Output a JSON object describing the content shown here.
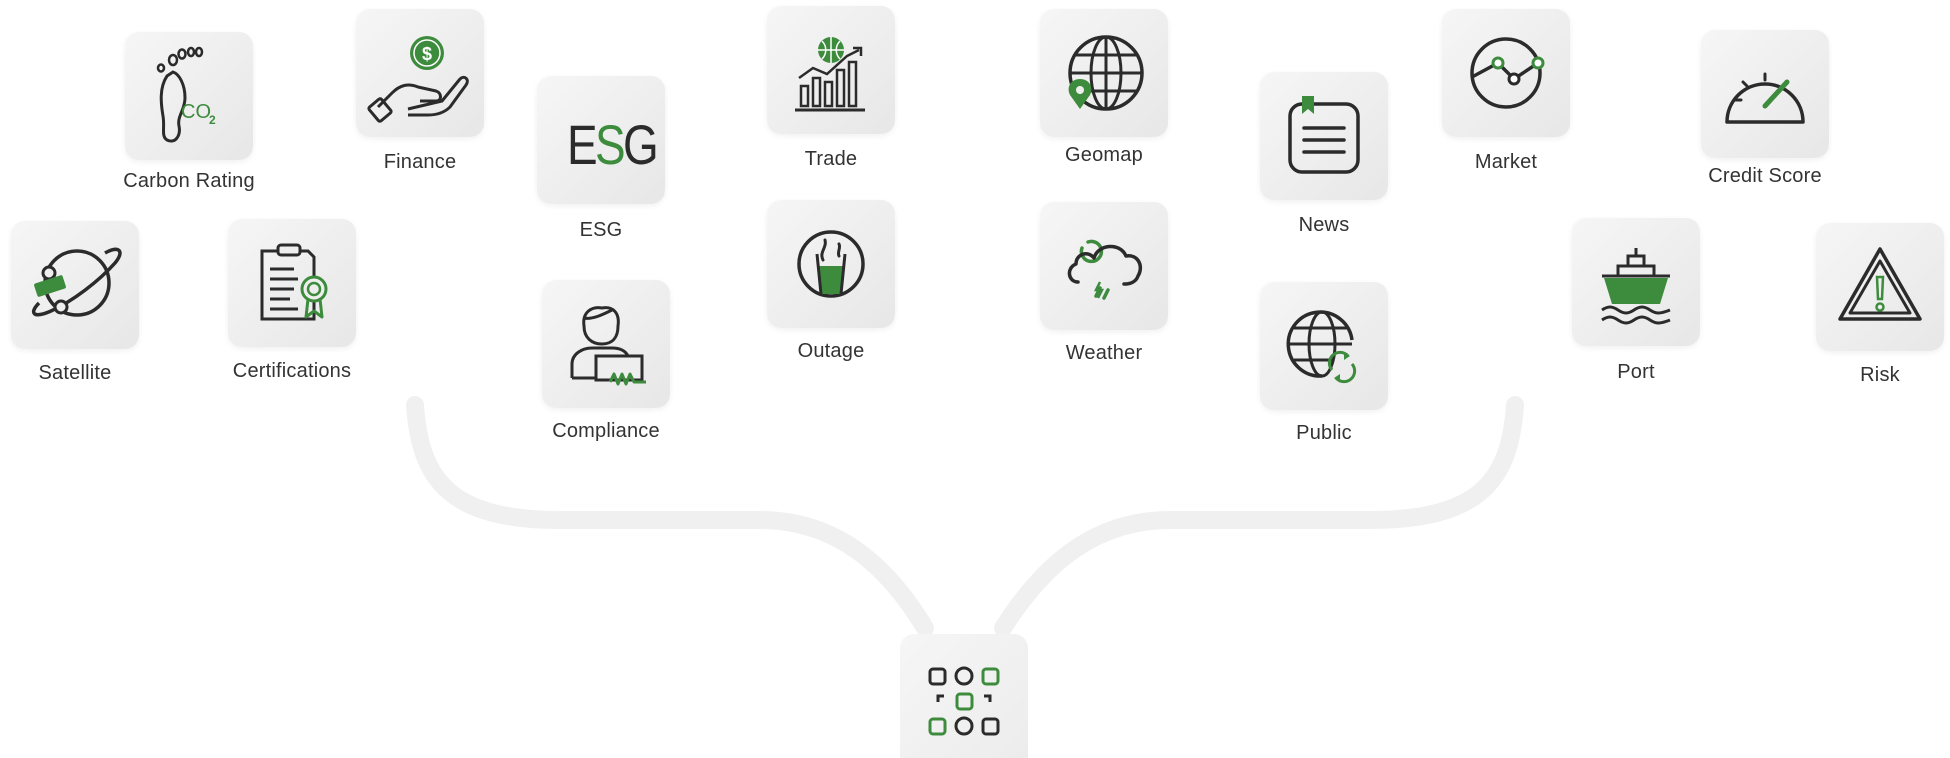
{
  "colors": {
    "accent": "#3d8b3d",
    "icon": "#2b2b2b",
    "tile": "#eeeeee",
    "connector": "#eeeeee",
    "label": "#333333"
  },
  "hub": {
    "icon": "apps-grid-icon"
  },
  "nodes": [
    {
      "label": "Carbon Rating",
      "icon": "carbon-footprint-icon"
    },
    {
      "label": "Finance",
      "icon": "money-hand-icon"
    },
    {
      "label": "ESG",
      "icon": "esg-icon"
    },
    {
      "label": "Trade",
      "icon": "trade-chart-icon"
    },
    {
      "label": "Geomap",
      "icon": "globe-pin-icon"
    },
    {
      "label": "News",
      "icon": "news-icon"
    },
    {
      "label": "Market",
      "icon": "market-line-icon"
    },
    {
      "label": "Credit Score",
      "icon": "speedometer-icon"
    },
    {
      "label": "Satellite",
      "icon": "satellite-icon"
    },
    {
      "label": "Certifications",
      "icon": "certificate-icon"
    },
    {
      "label": "Compliance",
      "icon": "compliance-person-icon"
    },
    {
      "label": "Outage",
      "icon": "outage-icon"
    },
    {
      "label": "Weather",
      "icon": "weather-cloud-icon"
    },
    {
      "label": "Public",
      "icon": "globe-refresh-icon"
    },
    {
      "label": "Port",
      "icon": "ship-icon"
    },
    {
      "label": "Risk",
      "icon": "warning-icon"
    }
  ]
}
